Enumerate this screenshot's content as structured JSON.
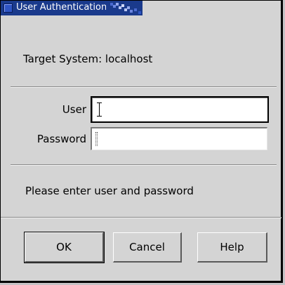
{
  "window": {
    "title": "User Authentication",
    "accent_color": "#1a3a8c",
    "icon": "window-icon"
  },
  "dialog": {
    "target_label": "Target System: localhost",
    "user_label": "User",
    "password_label": "Password",
    "user_value": "",
    "password_value": "",
    "status_message": "Please enter user and password"
  },
  "buttons": {
    "ok_label": "OK",
    "cancel_label": "Cancel",
    "help_label": "Help"
  }
}
